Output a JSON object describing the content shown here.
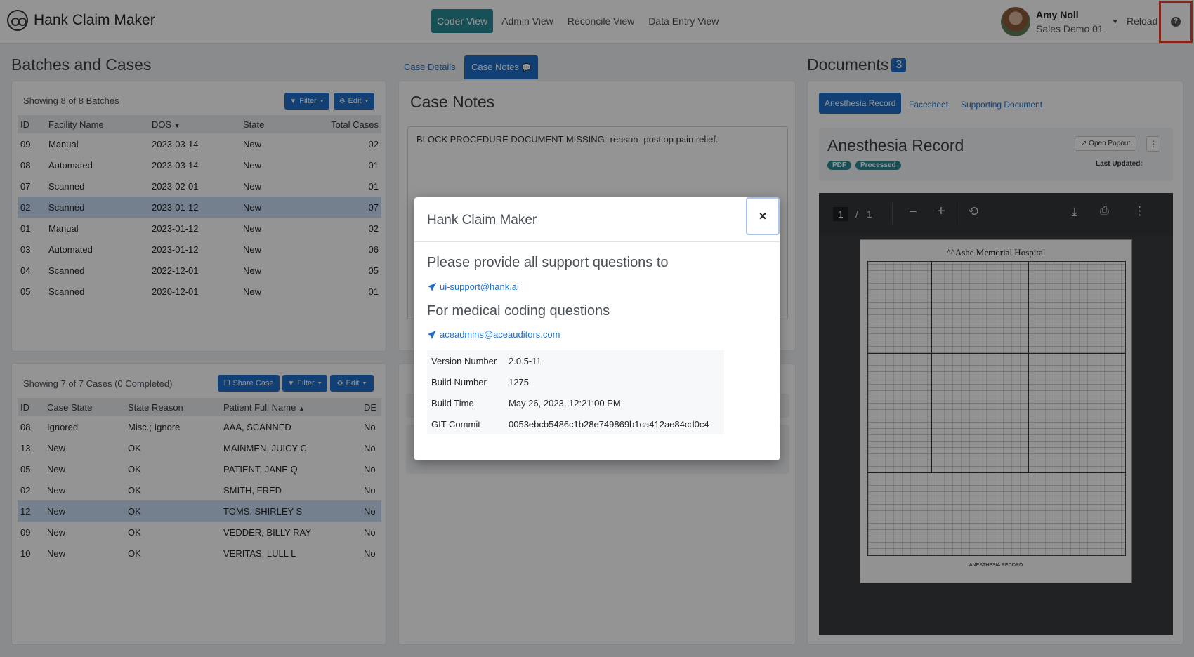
{
  "app": {
    "name": "Hank Claim Maker"
  },
  "nav": {
    "items": [
      "Coder View",
      "Admin View",
      "Reconcile View",
      "Data Entry View"
    ],
    "active": "Coder View"
  },
  "user": {
    "name": "Amy Noll",
    "org": "Sales Demo 01",
    "reload_label": "Reload"
  },
  "batches": {
    "title": "Batches and Cases",
    "showing": "Showing 8 of 8 Batches",
    "filter_label": "Filter",
    "edit_label": "Edit",
    "columns": [
      "ID",
      "Facility Name",
      "DOS",
      "State",
      "Total Cases"
    ],
    "rows": [
      {
        "id": "09",
        "facility": "Manual",
        "dos": "2023-03-14",
        "state": "New",
        "total": "02"
      },
      {
        "id": "08",
        "facility": "Automated",
        "dos": "2023-03-14",
        "state": "New",
        "total": "01"
      },
      {
        "id": "07",
        "facility": "Scanned",
        "dos": "2023-02-01",
        "state": "New",
        "total": "01"
      },
      {
        "id": "02",
        "facility": "Scanned",
        "dos": "2023-01-12",
        "state": "New",
        "total": "07"
      },
      {
        "id": "01",
        "facility": "Manual",
        "dos": "2023-01-12",
        "state": "New",
        "total": "02"
      },
      {
        "id": "03",
        "facility": "Automated",
        "dos": "2023-01-12",
        "state": "New",
        "total": "06"
      },
      {
        "id": "04",
        "facility": "Scanned",
        "dos": "2022-12-01",
        "state": "New",
        "total": "05"
      },
      {
        "id": "05",
        "facility": "Scanned",
        "dos": "2020-12-01",
        "state": "New",
        "total": "01"
      }
    ],
    "selected_id": "02"
  },
  "cases": {
    "showing": "Showing 7 of 7 Cases (0 Completed)",
    "share_label": "Share Case",
    "filter_label": "Filter",
    "edit_label": "Edit",
    "columns": [
      "ID",
      "Case State",
      "State Reason",
      "Patient Full Name",
      "DE"
    ],
    "rows": [
      {
        "id": "08",
        "state": "Ignored",
        "reason": "Misc.; Ignore",
        "patient": "AAA, SCANNED",
        "de": "No"
      },
      {
        "id": "13",
        "state": "New",
        "reason": "OK",
        "patient": "MAINMEN, JUICY C",
        "de": "No"
      },
      {
        "id": "05",
        "state": "New",
        "reason": "OK",
        "patient": "PATIENT, JANE Q",
        "de": "No"
      },
      {
        "id": "02",
        "state": "New",
        "reason": "OK",
        "patient": "SMITH, FRED",
        "de": "No"
      },
      {
        "id": "12",
        "state": "New",
        "reason": "OK",
        "patient": "TOMS, SHIRLEY S",
        "de": "No"
      },
      {
        "id": "09",
        "state": "New",
        "reason": "OK",
        "patient": "VEDDER, BILLY RAY",
        "de": "No"
      },
      {
        "id": "10",
        "state": "New",
        "reason": "OK",
        "patient": "VERITAS, LULL L",
        "de": "No"
      }
    ],
    "selected_id": "12"
  },
  "case_panel": {
    "tab_details": "Case Details",
    "tab_notes": "Case Notes",
    "title": "Case Notes",
    "note_text": "BLOCK PROCEDURE DOCUMENT MISSING- reason- post op pain relief."
  },
  "documents": {
    "title": "Documents",
    "count": "3",
    "tabs": [
      "Anesthesia Record",
      "Facesheet",
      "Supporting Document"
    ],
    "active_tab": "Anesthesia Record",
    "doc_title": "Anesthesia Record",
    "pill_pdf": "PDF",
    "pill_status": "Processed",
    "open_popout": "Open Popout",
    "last_updated": "Last Updated:",
    "viewer": {
      "page_current": "1",
      "page_sep": "/",
      "page_total": "1",
      "hospital": "^^Ashe Memorial Hospital",
      "footer": "ANESTHESIA RECORD"
    }
  },
  "modal": {
    "title": "Hank Claim Maker",
    "close_label": "×",
    "support_heading": "Please provide all support questions to",
    "support_email": "ui-support@hank.ai",
    "coding_heading": "For medical coding questions",
    "coding_email": "aceadmins@aceauditors.com",
    "info": [
      {
        "label": "Version Number",
        "value": "2.0.5-11"
      },
      {
        "label": "Build Number",
        "value": "1275"
      },
      {
        "label": "Build Time",
        "value": "May 26, 2023, 12:21:00 PM"
      },
      {
        "label": "GIT Commit",
        "value": "0053ebcb5486c1b28e749869b1ca412ae84cd0c4"
      }
    ]
  },
  "colors": {
    "primary": "#1f6fc9",
    "nav_active": "#2a8a96",
    "highlight_border": "#e5432e",
    "selected_row": "#c9dcf3"
  }
}
